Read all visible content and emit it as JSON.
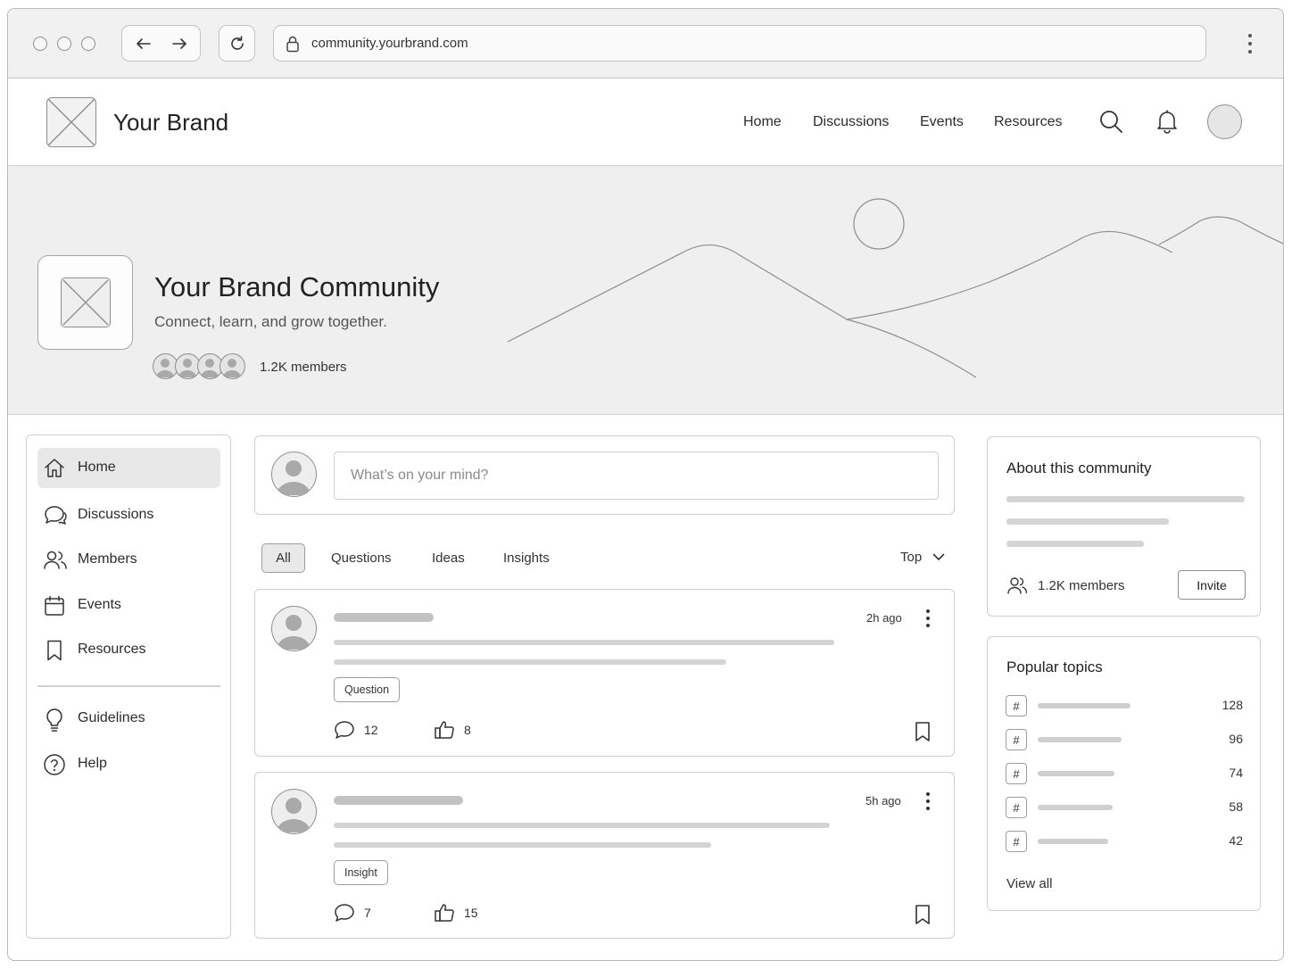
{
  "browser": {
    "url": "community.yourbrand.com"
  },
  "header": {
    "brand_name": "Your Brand",
    "nav": [
      "Home",
      "Discussions",
      "Events",
      "Resources"
    ]
  },
  "hero": {
    "title": "Your Brand Community",
    "subtitle": "Connect, learn, and grow together.",
    "member_count": "1.2K members"
  },
  "sidebar": {
    "items": [
      {
        "label": "Home",
        "icon": "home-icon",
        "active": true
      },
      {
        "label": "Discussions",
        "icon": "discussions-icon"
      },
      {
        "label": "Members",
        "icon": "members-icon"
      },
      {
        "label": "Events",
        "icon": "calendar-icon"
      },
      {
        "label": "Resources",
        "icon": "bookmark-icon"
      }
    ],
    "secondary": [
      {
        "label": "Guidelines",
        "icon": "lightbulb-icon"
      },
      {
        "label": "Help",
        "icon": "help-icon"
      }
    ]
  },
  "composer": {
    "placeholder": "What’s on your mind?"
  },
  "filters": {
    "tabs": [
      "All",
      "Questions",
      "Ideas",
      "Insights"
    ],
    "active": "All",
    "sort": "Top"
  },
  "posts": [
    {
      "time": "2h ago",
      "tag": "Question",
      "comments": "12",
      "likes": "8"
    },
    {
      "time": "5h ago",
      "tag": "Insight",
      "comments": "7",
      "likes": "15"
    }
  ],
  "about": {
    "title": "About this community",
    "members": "1.2K members",
    "invite_label": "Invite"
  },
  "topics": {
    "title": "Popular topics",
    "items": [
      {
        "hash": "#",
        "count": "128"
      },
      {
        "hash": "#",
        "count": "96"
      },
      {
        "hash": "#",
        "count": "74"
      },
      {
        "hash": "#",
        "count": "58"
      },
      {
        "hash": "#",
        "count": "42"
      }
    ],
    "view_all": "View all"
  }
}
